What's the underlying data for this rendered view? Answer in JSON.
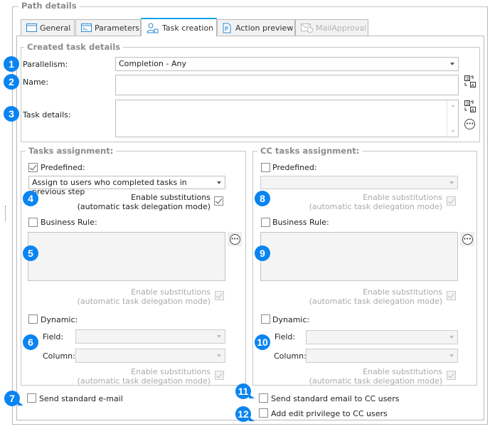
{
  "section_title": "Path details",
  "tabs": [
    {
      "label": "General",
      "icon": "window-icon",
      "state": "normal"
    },
    {
      "label": "Parameters",
      "icon": "console-window-icon",
      "state": "normal"
    },
    {
      "label": "Task creation",
      "icon": "users-task-icon",
      "state": "active"
    },
    {
      "label": "Action preview",
      "icon": "document-preview-icon",
      "state": "normal"
    },
    {
      "label": "MailApproval",
      "icon": "mail-check-icon",
      "state": "disabled"
    }
  ],
  "created_task_details": {
    "title": "Created task details",
    "parallelism": {
      "label": "Parallelism:",
      "value": "Completion - Any"
    },
    "name": {
      "label": "Name:",
      "value": ""
    },
    "task_details": {
      "label": "Task details:",
      "value": ""
    }
  },
  "tasks_assignment": {
    "title": "Tasks assignment:",
    "predefined": {
      "label": "Predefined:",
      "checked": true,
      "value": "Assign to users who completed tasks in previous step"
    },
    "substitutions_line1": "Enable substitutions",
    "substitutions_line2": "(automatic task delegation mode)",
    "business_rule": {
      "label": "Business Rule:",
      "checked": false
    },
    "dynamic": {
      "label": "Dynamic:",
      "checked": false,
      "field_label": "Field:",
      "column_label": "Column:",
      "field_value": "",
      "column_value": ""
    }
  },
  "cc_tasks_assignment": {
    "title": "CC tasks assignment:",
    "predefined": {
      "label": "Predefined:",
      "checked": false,
      "value": ""
    },
    "substitutions_line1": "Enable substitutions",
    "substitutions_line2": "(automatic task delegation mode)",
    "business_rule": {
      "label": "Business Rule:",
      "checked": false
    },
    "dynamic": {
      "label": "Dynamic:",
      "checked": false,
      "field_label": "Field:",
      "column_label": "Column:",
      "field_value": "",
      "column_value": ""
    }
  },
  "options": {
    "send_standard_email": {
      "label": "Send standard e-mail",
      "checked": false
    },
    "send_email_cc": {
      "label": "Send standard email to CC users",
      "checked": false
    },
    "add_edit_privilege_cc": {
      "label": "Add edit privilege to CC users",
      "checked": false
    }
  },
  "badges": [
    "1",
    "2",
    "3",
    "4",
    "5",
    "6",
    "7",
    "8",
    "9",
    "10",
    "11",
    "12"
  ],
  "colors": {
    "accent": "#13a3e8",
    "badge": "#0a84f0"
  }
}
